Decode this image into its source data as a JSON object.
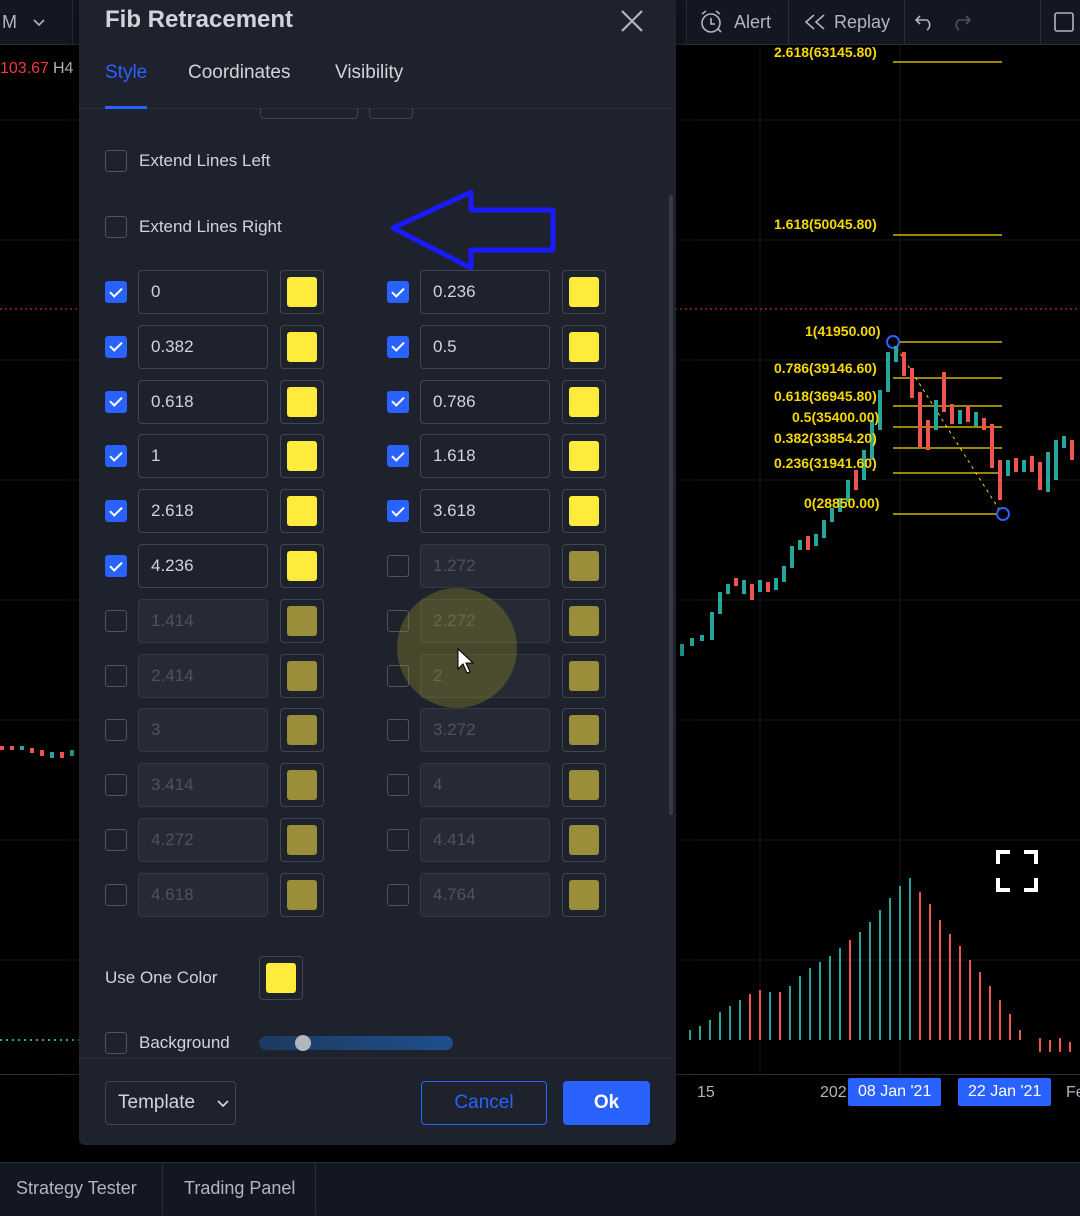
{
  "toolbar": {
    "interval": "M",
    "alert_label": "Alert",
    "replay_label": "Replay"
  },
  "chart": {
    "price_value": "103.67",
    "price_suffix": "H4",
    "fib_levels": [
      {
        "text": "2.618(63145.80)"
      },
      {
        "text": "1.618(50045.80)"
      },
      {
        "text": "1(41950.00)"
      },
      {
        "text": "0.786(39146.60)"
      },
      {
        "text": "0.618(36945.80)"
      },
      {
        "text": "0.5(35400.00)"
      },
      {
        "text": "0.382(33854.20)"
      },
      {
        "text": "0.236(31941.60)"
      },
      {
        "text": "0(28850.00)"
      }
    ],
    "axis": {
      "labels": [
        "15",
        "202",
        "Fe"
      ],
      "pills": [
        "08 Jan '21",
        "22 Jan '21"
      ]
    }
  },
  "bottom": {
    "tabs": [
      "Strategy Tester",
      "Trading Panel"
    ]
  },
  "dialog": {
    "title": "Fib Retracement",
    "tabs": [
      {
        "label": "Style",
        "active": true
      },
      {
        "label": "Coordinates",
        "active": false
      },
      {
        "label": "Visibility",
        "active": false
      }
    ],
    "extend_left": {
      "label": "Extend Lines Left",
      "checked": false
    },
    "extend_right": {
      "label": "Extend Lines Right",
      "checked": false
    },
    "levels_left": [
      {
        "value": "0",
        "enabled": true
      },
      {
        "value": "0.382",
        "enabled": true
      },
      {
        "value": "0.618",
        "enabled": true
      },
      {
        "value": "1",
        "enabled": true
      },
      {
        "value": "2.618",
        "enabled": true
      },
      {
        "value": "4.236",
        "enabled": true
      },
      {
        "value": "1.414",
        "enabled": false
      },
      {
        "value": "2.414",
        "enabled": false
      },
      {
        "value": "3",
        "enabled": false
      },
      {
        "value": "3.414",
        "enabled": false
      },
      {
        "value": "4.272",
        "enabled": false
      },
      {
        "value": "4.618",
        "enabled": false
      }
    ],
    "levels_right": [
      {
        "value": "0.236",
        "enabled": true
      },
      {
        "value": "0.5",
        "enabled": true
      },
      {
        "value": "0.786",
        "enabled": true
      },
      {
        "value": "1.618",
        "enabled": true
      },
      {
        "value": "3.618",
        "enabled": true
      },
      {
        "value": "1.272",
        "enabled": false
      },
      {
        "value": "2.272",
        "enabled": false
      },
      {
        "value": "2",
        "enabled": false
      },
      {
        "value": "3.272",
        "enabled": false
      },
      {
        "value": "4",
        "enabled": false
      },
      {
        "value": "4.414",
        "enabled": false
      },
      {
        "value": "4.764",
        "enabled": false
      }
    ],
    "use_one_color_label": "Use One Color",
    "background": {
      "label": "Background",
      "checked": false
    },
    "template_label": "Template",
    "cancel_label": "Cancel",
    "ok_label": "Ok"
  },
  "colors": {
    "accent": "#2962ff",
    "level_color": "#ffeb3b",
    "fib_text": "#f5d800",
    "up_candle": "#26a69a",
    "down_candle": "#ef5350"
  }
}
